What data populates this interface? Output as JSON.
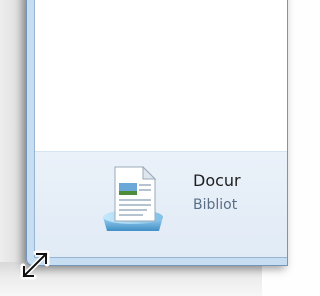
{
  "details_pane": {
    "item_name": "Docur",
    "item_type": "Bibliot",
    "icon": "documents-library-icon"
  },
  "window": {
    "resize_handle_icon": "resize-diagonal-icon"
  },
  "colors": {
    "frame": "#c7ddf1",
    "frame_border": "#7596b5",
    "details_background": "#e4edf7",
    "secondary_text": "#5a6f86"
  }
}
